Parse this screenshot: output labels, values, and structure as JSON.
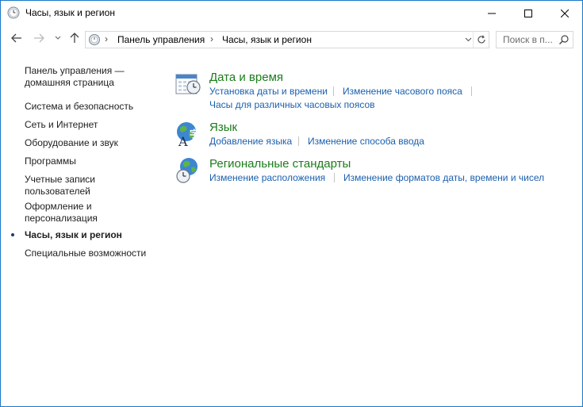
{
  "window": {
    "title": "Часы, язык и регион"
  },
  "navigation": {
    "back_icon": "arrow-left-icon",
    "forward_icon": "arrow-right-icon",
    "recent_icon": "chevron-down-icon",
    "up_icon": "arrow-up-icon"
  },
  "address": {
    "root": "Панель управления",
    "current": "Часы, язык и регион",
    "separator": "›"
  },
  "search": {
    "placeholder": "Поиск в п..."
  },
  "sidebar": {
    "home_line1": "Панель управления —",
    "home_line2": "домашняя страница",
    "items": [
      "Система и безопасность",
      "Сеть и Интернет",
      "Оборудование и звук",
      "Программы"
    ],
    "accounts_line1": "Учетные записи",
    "accounts_line2": "пользователей",
    "appearance_line1": "Оформление и",
    "appearance_line2": "персонализация",
    "active": "Часы, язык и регион",
    "accessibility": "Специальные возможности"
  },
  "categories": {
    "datetime": {
      "title": "Дата и время",
      "links": [
        "Установка даты и времени",
        "Изменение часового пояса",
        "Часы для различных часовых поясов"
      ]
    },
    "language": {
      "title": "Язык",
      "links": [
        "Добавление языка",
        "Изменение способа ввода"
      ]
    },
    "regional": {
      "title": "Региональные стандарты",
      "links": [
        "Изменение расположения",
        "Изменение форматов даты, времени и чисел"
      ]
    }
  },
  "colors": {
    "category_title": "#1a7d1a",
    "link": "#1a5fae",
    "window_border": "#1979ca"
  }
}
